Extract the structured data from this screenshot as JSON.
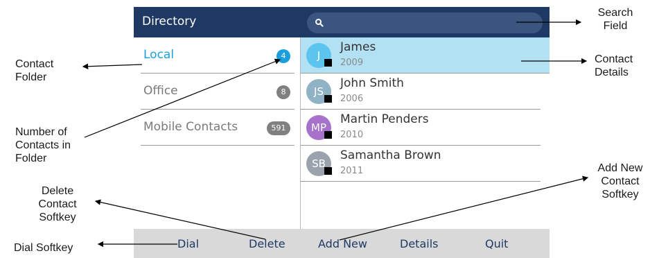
{
  "screen": {
    "title": "Directory",
    "search": {
      "placeholder": "",
      "icon": "search-icon"
    },
    "folders": [
      {
        "label": "Local",
        "count": "4",
        "active": true
      },
      {
        "label": "Office",
        "count": "8",
        "active": false
      },
      {
        "label": "Mobile Contacts",
        "count": "591",
        "active": false
      }
    ],
    "contacts": [
      {
        "initials": "J",
        "name": "James",
        "number": "2009",
        "avatar_color": "#5bc5ef",
        "selected": true
      },
      {
        "initials": "JS",
        "name": "John Smith",
        "number": "2006",
        "avatar_color": "#8fb2c4",
        "selected": false
      },
      {
        "initials": "MP",
        "name": "Martin Penders",
        "number": "2010",
        "avatar_color": "#a772c9",
        "selected": false
      },
      {
        "initials": "SB",
        "name": "Samantha Brown",
        "number": "2011",
        "avatar_color": "#9aa3ad",
        "selected": false
      }
    ],
    "softkeys": [
      "Dial",
      "Delete",
      "Add New",
      "Details",
      "Quit"
    ]
  },
  "annotations": {
    "search_field": "Search\nField",
    "contact_details": "Contact\nDetails",
    "contact_folder": "Contact\nFolder",
    "number_of_contacts": "Number of\nContacts in\nFolder",
    "delete_softkey": "Delete\nContact\nSoftkey",
    "add_new_softkey": "Add New\nContact\nSoftkey",
    "dial_softkey": "Dial Softkey"
  },
  "colors": {
    "header": "#1e3a64",
    "accent": "#1a9ede",
    "selected_row": "#b3e1f4",
    "softkey_bar": "#d9d9d9"
  }
}
